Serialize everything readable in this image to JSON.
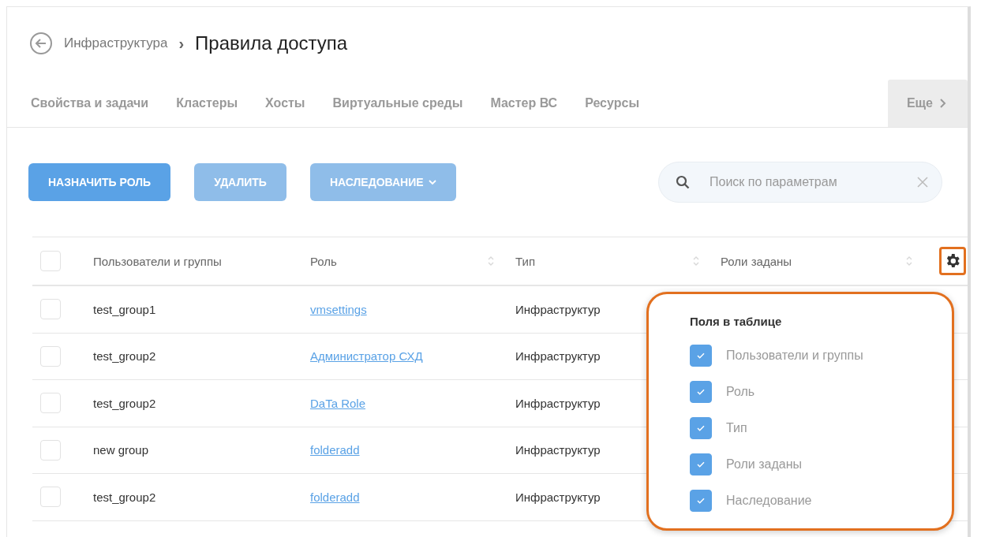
{
  "breadcrumb": {
    "parent": "Инфраструктура",
    "separator": "›",
    "title": "Правила доступа"
  },
  "tabs": [
    {
      "label": "Свойства и задачи",
      "selected": false
    },
    {
      "label": "Кластеры",
      "selected": false
    },
    {
      "label": "Хосты",
      "selected": false
    },
    {
      "label": "Виртуальные среды",
      "selected": false
    },
    {
      "label": "Мастер ВС",
      "selected": false
    },
    {
      "label": "Ресурсы",
      "selected": false
    }
  ],
  "more_tab": {
    "label": "Еще"
  },
  "toolbar": {
    "buttons": [
      {
        "label": "НАЗНАЧИТЬ РОЛЬ",
        "disabled": false,
        "dropdown": false
      },
      {
        "label": "УДАЛИТЬ",
        "disabled": true,
        "dropdown": false
      },
      {
        "label": "НАСЛЕДОВАНИЕ",
        "disabled": true,
        "dropdown": true
      }
    ],
    "search": {
      "placeholder": "Поиск по параметрам"
    }
  },
  "table": {
    "header_checked": false,
    "columns": [
      {
        "label": "Пользователи и группы",
        "sortable": false
      },
      {
        "label": "Роль",
        "sortable": true
      },
      {
        "label": "Тип",
        "sortable": true
      },
      {
        "label": "Роли заданы",
        "sortable": true
      }
    ],
    "rows": [
      {
        "checked": false,
        "user": "test_group1",
        "role": "vmsettings",
        "type": "Инфраструктур"
      },
      {
        "checked": false,
        "user": "test_group2",
        "role": "Администратор СХД",
        "type": "Инфраструктур"
      },
      {
        "checked": false,
        "user": "test_group2",
        "role": "DaTa Role",
        "type": "Инфраструктур"
      },
      {
        "checked": false,
        "user": "new group",
        "role": "folderadd",
        "type": "Инфраструктур"
      },
      {
        "checked": false,
        "user": "test_group2",
        "role": "folderadd",
        "type": "Инфраструктур"
      }
    ]
  },
  "fields_popup": {
    "title": "Поля в таблице",
    "highlighted": true,
    "fields": [
      {
        "label": "Пользователи и группы",
        "checked": true
      },
      {
        "label": "Роль",
        "checked": true
      },
      {
        "label": "Тип",
        "checked": true
      },
      {
        "label": "Роли заданы",
        "checked": true
      },
      {
        "label": "Наследование",
        "checked": true
      }
    ]
  }
}
